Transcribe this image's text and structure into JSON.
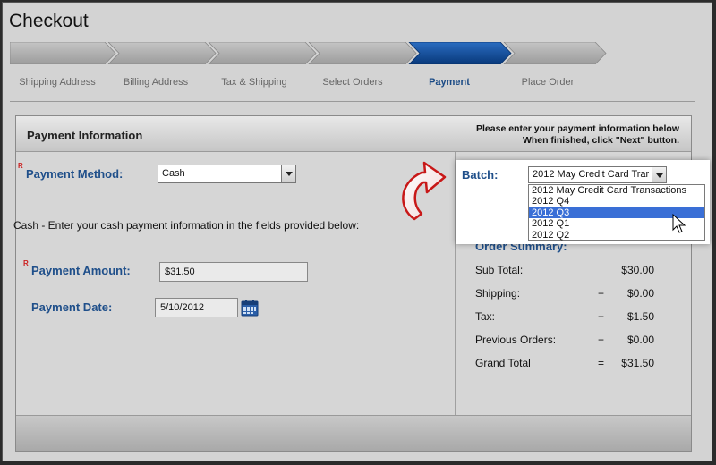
{
  "page": {
    "title": "Checkout"
  },
  "steps": [
    {
      "label": "Shipping Address",
      "active": false
    },
    {
      "label": "Billing Address",
      "active": false
    },
    {
      "label": "Tax & Shipping",
      "active": false
    },
    {
      "label": "Select Orders",
      "active": false
    },
    {
      "label": "Payment",
      "active": true
    },
    {
      "label": "Place Order",
      "active": false
    }
  ],
  "panel": {
    "title": "Payment Information",
    "note_line1": "Please enter your payment information below",
    "note_line2": "When finished, click \"Next\" button."
  },
  "form": {
    "required_mark": "R",
    "payment_method_label": "Payment Method:",
    "payment_method_value": "Cash",
    "cash_instructions": "Cash - Enter your cash payment information in the fields provided below:",
    "payment_amount_label": "Payment Amount:",
    "payment_amount_value": "$31.50",
    "payment_date_label": "Payment Date:",
    "payment_date_value": "5/10/2012"
  },
  "batch": {
    "label": "Batch:",
    "selected_value": "2012 May Credit Card Trar",
    "options": [
      "2012 May Credit Card Transactions",
      "2012 Q4",
      "2012 Q3",
      "2012 Q1",
      "2012 Q2"
    ],
    "highlighted_option": "2012 Q3"
  },
  "summary": {
    "title": "Order Summary:",
    "rows": [
      {
        "label": "Sub Total:",
        "op": "",
        "value": "$30.00"
      },
      {
        "label": "Shipping:",
        "op": "+",
        "value": "$0.00"
      },
      {
        "label": "Tax:",
        "op": "+",
        "value": "$1.50"
      },
      {
        "label": "Previous Orders:",
        "op": "+",
        "value": "$0.00"
      },
      {
        "label": "Grand Total",
        "op": "=",
        "value": "$31.50"
      }
    ]
  },
  "colors": {
    "active_step": "#0a4a9a",
    "inactive_step": "#a8a8a8",
    "label_blue": "#1f4f8a",
    "required_red": "#cc2020",
    "selected_option": "#3a6fd6"
  },
  "icons": {
    "calendar": "calendar-icon",
    "dropdown": "chevron-down-icon",
    "callout": "curved-arrow-icon",
    "cursor": "mouse-pointer-icon"
  }
}
